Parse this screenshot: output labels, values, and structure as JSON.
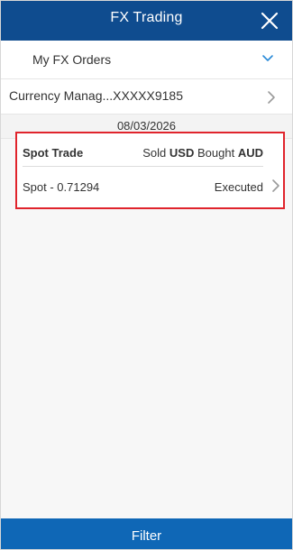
{
  "header": {
    "title": "FX Trading",
    "close_icon": "close-icon"
  },
  "orders": {
    "label": "My FX Orders",
    "icon": "chevron-down-icon"
  },
  "account": {
    "label": "Currency Manag...XXXXX9185",
    "icon": "chevron-right-icon"
  },
  "date": "08/03/2026",
  "trade": {
    "type": "Spot Trade",
    "sold_prefix": "Sold",
    "sold_currency": "USD",
    "bought_prefix": "Bought",
    "bought_currency": "AUD",
    "rate_label": "Spot - 0.71294",
    "status": "Executed"
  },
  "filter": {
    "label": "Filter"
  },
  "colors": {
    "header_bg": "#0f4c8f",
    "filter_bg": "#0f67b6",
    "highlight_border": "#e0242c",
    "accent_chevron": "#2a8ad8"
  }
}
